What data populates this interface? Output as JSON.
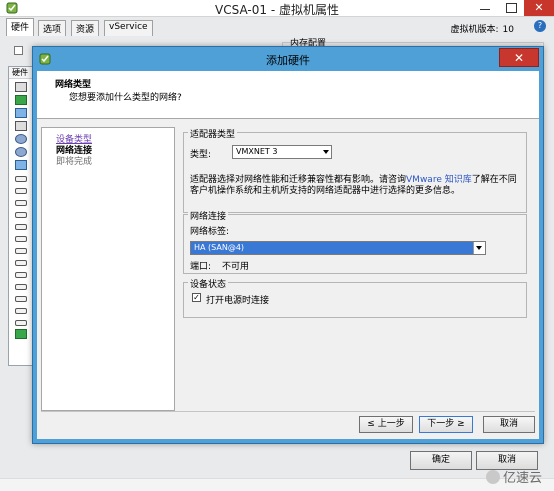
{
  "window": {
    "title": "VCSA-01 - 虚拟机属性",
    "close_glyph": "✕"
  },
  "parent": {
    "tabs": [
      "硬件",
      "选项",
      "资源",
      "vService"
    ],
    "hw_version_label": "虚拟机版本:",
    "hw_version_value": "10",
    "memory_label": "内存配置",
    "left_header": "硬件",
    "ok_label": "确定",
    "cancel_label": "取消"
  },
  "dialog": {
    "title": "添加硬件",
    "close_glyph": "✕",
    "header_title": "网络类型",
    "header_subtitle": "您想要添加什么类型的网络?",
    "steps": [
      {
        "label": "设备类型",
        "state": "link"
      },
      {
        "label": "网络连接",
        "state": "current"
      },
      {
        "label": "即将完成",
        "state": "pending"
      }
    ],
    "adapter_group": {
      "legend": "适配器类型",
      "type_label": "类型:",
      "type_value": "VMXNET 3",
      "desc_before": "适配器选择对网络性能和迁移兼容性都有影响。请咨询",
      "desc_link": "VMware 知识库",
      "desc_after": "了解在不同客户机操作系统和主机所支持的网络适配器中进行选择的更多信息。"
    },
    "network_group": {
      "legend": "网络连接",
      "label_label": "网络标签:",
      "label_value": "HA (SAN@4)",
      "port_label": "端口:",
      "port_value": "不可用"
    },
    "device_group": {
      "legend": "设备状态",
      "checkbox_label": "打开电源时连接",
      "checked": true,
      "check_glyph": "✓"
    },
    "buttons": {
      "back": "≤ 上一步",
      "next": "下一步 ≥",
      "cancel": "取消"
    }
  },
  "watermark": {
    "text": "亿速云"
  },
  "colors": {
    "dialog_frame": "#4fa0d6",
    "close_red": "#c8372d",
    "selection_blue": "#3a78d6",
    "link_purple": "#6b3fb0",
    "link_blue": "#2a55c4"
  }
}
